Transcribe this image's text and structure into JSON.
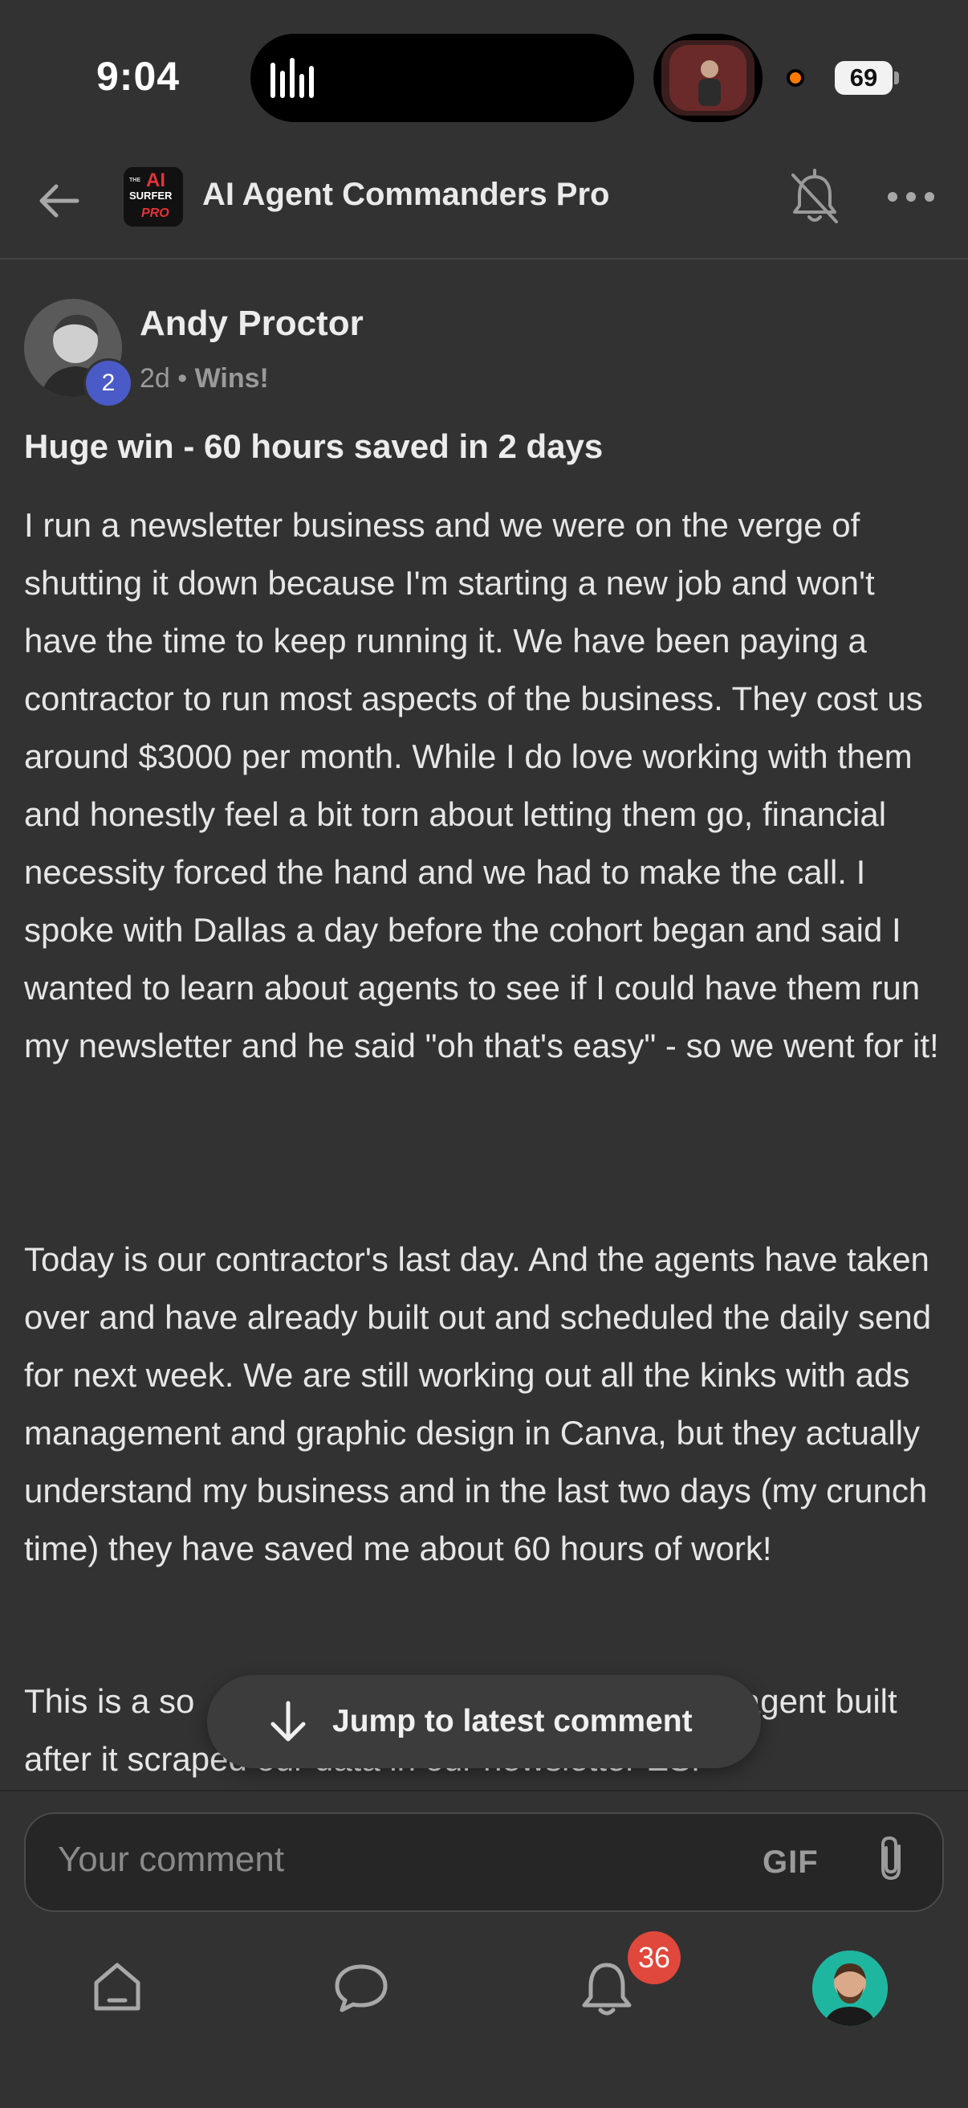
{
  "status_bar": {
    "time": "9:04",
    "battery": "69"
  },
  "header": {
    "title": "AI Agent Commanders Pro",
    "logo_text": {
      "line1": "THE",
      "line2": "AI",
      "line3": "SURFER",
      "line4": "PRO"
    }
  },
  "post": {
    "author": "Andy Proctor",
    "level": "2",
    "age": "2d",
    "separator": "•",
    "category": "Wins!",
    "title": "Huge win - 60 hours saved in 2 days",
    "paragraphs": [
      "I run a newsletter business and we were on the verge of shutting it down because I'm starting a new job and won't have the time to keep running it. We have been paying a contractor to run most aspects of the business. They cost us around $3000 per month. While I do love working with them and honestly feel a bit torn about letting them go, financial necessity forced the hand and we had to make the call. I spoke with Dallas a day before the cohort began and said I wanted to learn about agents to see if I could have them run my newsletter and he said \"oh that's easy\" - so we went for it!",
      "Today is our contractor's last day. And the agents have taken over and have already built out and scheduled the daily send for next week. We are still working out all the kinks with ads management and graphic design in Canva, but they actually understand my business and in the last two days (my crunch time) they have saved me about 60 hours of work!",
      "This is a so                                                    lyst agent built after it scraped our data in our newsletter ESP"
    ]
  },
  "jump": {
    "label": "Jump to latest comment"
  },
  "comment": {
    "placeholder": "Your comment",
    "gif_label": "GIF"
  },
  "nav": {
    "notification_count": "36"
  },
  "colors": {
    "background": "#323232",
    "badge_level": "#4a5ac7",
    "notification_badge": "#e0483b",
    "status_dot": "#ff7a00"
  },
  "icons": [
    "back-arrow-icon",
    "bell-off-icon",
    "more-icon",
    "arrow-down-icon",
    "paperclip-icon",
    "home-icon",
    "chat-icon",
    "bell-icon"
  ]
}
